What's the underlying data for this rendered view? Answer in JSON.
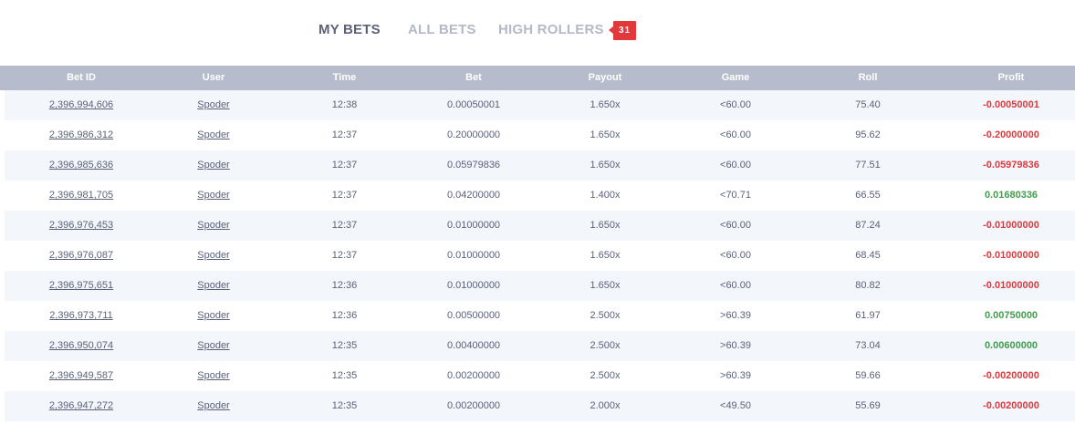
{
  "tabs": [
    {
      "label": "MY BETS",
      "active": true
    },
    {
      "label": "ALL BETS",
      "active": false
    },
    {
      "label": "HIGH ROLLERS",
      "active": false
    }
  ],
  "badge": {
    "count": "31",
    "color": "#e2373b"
  },
  "colors": {
    "header_bg": "#b6bccc",
    "text": "#5b6278",
    "negative": "#e2373b",
    "positive": "#3ea04a",
    "row_stripe": "#f3f6fb"
  },
  "table": {
    "headers": {
      "bet_id": "Bet ID",
      "user": "User",
      "time": "Time",
      "bet": "Bet",
      "payout": "Payout",
      "game": "Game",
      "roll": "Roll",
      "profit": "Profit"
    },
    "rows": [
      {
        "bet_id": "2,396,994,606",
        "user": "Spoder",
        "time": "12:38",
        "bet": "0.00050001",
        "payout": "1.650x",
        "game": "<60.00",
        "roll": "75.40",
        "profit": "-0.00050001",
        "win": false
      },
      {
        "bet_id": "2,396,986,312",
        "user": "Spoder",
        "time": "12:37",
        "bet": "0.20000000",
        "payout": "1.650x",
        "game": "<60.00",
        "roll": "95.62",
        "profit": "-0.20000000",
        "win": false
      },
      {
        "bet_id": "2,396,985,636",
        "user": "Spoder",
        "time": "12:37",
        "bet": "0.05979836",
        "payout": "1.650x",
        "game": "<60.00",
        "roll": "77.51",
        "profit": "-0.05979836",
        "win": false
      },
      {
        "bet_id": "2,396,981,705",
        "user": "Spoder",
        "time": "12:37",
        "bet": "0.04200000",
        "payout": "1.400x",
        "game": "<70.71",
        "roll": "66.55",
        "profit": "0.01680336",
        "win": true
      },
      {
        "bet_id": "2,396,976,453",
        "user": "Spoder",
        "time": "12:37",
        "bet": "0.01000000",
        "payout": "1.650x",
        "game": "<60.00",
        "roll": "87.24",
        "profit": "-0.01000000",
        "win": false
      },
      {
        "bet_id": "2,396,976,087",
        "user": "Spoder",
        "time": "12:37",
        "bet": "0.01000000",
        "payout": "1.650x",
        "game": "<60.00",
        "roll": "68.45",
        "profit": "-0.01000000",
        "win": false
      },
      {
        "bet_id": "2,396,975,651",
        "user": "Spoder",
        "time": "12:36",
        "bet": "0.01000000",
        "payout": "1.650x",
        "game": "<60.00",
        "roll": "80.82",
        "profit": "-0.01000000",
        "win": false
      },
      {
        "bet_id": "2,396,973,711",
        "user": "Spoder",
        "time": "12:36",
        "bet": "0.00500000",
        "payout": "2.500x",
        "game": ">60.39",
        "roll": "61.97",
        "profit": "0.00750000",
        "win": true
      },
      {
        "bet_id": "2,396,950,074",
        "user": "Spoder",
        "time": "12:35",
        "bet": "0.00400000",
        "payout": "2.500x",
        "game": ">60.39",
        "roll": "73.04",
        "profit": "0.00600000",
        "win": true
      },
      {
        "bet_id": "2,396,949,587",
        "user": "Spoder",
        "time": "12:35",
        "bet": "0.00200000",
        "payout": "2.500x",
        "game": ">60.39",
        "roll": "59.66",
        "profit": "-0.00200000",
        "win": false
      },
      {
        "bet_id": "2,396,947,272",
        "user": "Spoder",
        "time": "12:35",
        "bet": "0.00200000",
        "payout": "2.000x",
        "game": "<49.50",
        "roll": "55.69",
        "profit": "-0.00200000",
        "win": false
      }
    ]
  }
}
